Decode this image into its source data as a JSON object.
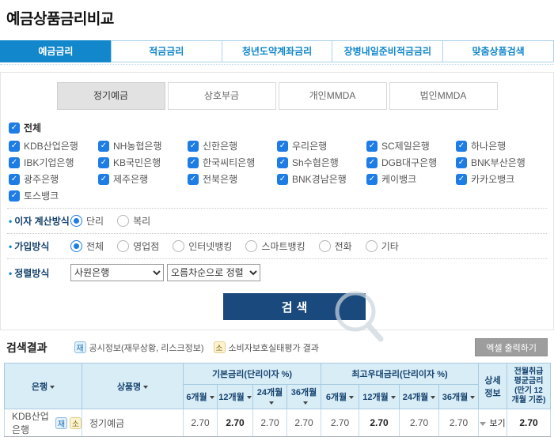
{
  "page": {
    "title": "예금상품금리비교"
  },
  "tabs": [
    {
      "label": "예금금리",
      "active": true
    },
    {
      "label": "적금금리",
      "active": false
    },
    {
      "label": "청년도약계좌금리",
      "active": false
    },
    {
      "label": "장병내일준비적금금리",
      "active": false
    },
    {
      "label": "맞춤상품검색",
      "active": false
    }
  ],
  "subtabs": [
    {
      "label": "정기예금",
      "active": true
    },
    {
      "label": "상호부금",
      "active": false
    },
    {
      "label": "개인MMDA",
      "active": false
    },
    {
      "label": "법인MMDA",
      "active": false
    }
  ],
  "banks": {
    "all_label": "전체",
    "items": [
      {
        "label": "KDB산업은행",
        "checked": true
      },
      {
        "label": "NH농협은행",
        "checked": true
      },
      {
        "label": "신한은행",
        "checked": true
      },
      {
        "label": "우리은행",
        "checked": true
      },
      {
        "label": "SC제일은행",
        "checked": true
      },
      {
        "label": "하나은행",
        "checked": true
      },
      {
        "label": "IBK기업은행",
        "checked": true
      },
      {
        "label": "KB국민은행",
        "checked": true
      },
      {
        "label": "한국씨티은행",
        "checked": true
      },
      {
        "label": "Sh수협은행",
        "checked": true
      },
      {
        "label": "DGB대구은행",
        "checked": true
      },
      {
        "label": "BNK부산은행",
        "checked": true
      },
      {
        "label": "광주은행",
        "checked": true
      },
      {
        "label": "제주은행",
        "checked": true
      },
      {
        "label": "전북은행",
        "checked": true
      },
      {
        "label": "BNK경남은행",
        "checked": true
      },
      {
        "label": "케이뱅크",
        "checked": true
      },
      {
        "label": "카카오뱅크",
        "checked": true
      },
      {
        "label": "토스뱅크",
        "checked": true
      }
    ]
  },
  "filters": {
    "interest_calc": {
      "label": "이자 계산방식",
      "options": [
        {
          "label": "단리",
          "selected": true
        },
        {
          "label": "복리",
          "selected": false
        }
      ]
    },
    "join_method": {
      "label": "가입방식",
      "options": [
        {
          "label": "전체",
          "selected": true
        },
        {
          "label": "영업점",
          "selected": false
        },
        {
          "label": "인터넷뱅킹",
          "selected": false
        },
        {
          "label": "스마트뱅킹",
          "selected": false
        },
        {
          "label": "전화",
          "selected": false
        },
        {
          "label": "기타",
          "selected": false
        }
      ]
    },
    "sort": {
      "label": "정렬방식",
      "select1_value": "사원은행",
      "select2_value": "오름차순으로 정렬"
    }
  },
  "search_button_label": "검색",
  "results": {
    "title": "검색결과",
    "legend": [
      {
        "badge": "재",
        "label": "공시정보(재무상황, 리스크정보)"
      },
      {
        "badge": "소",
        "label": "소비자보호실태평가 결과"
      }
    ],
    "excel_button_label": "엑셀 출력하기"
  },
  "table": {
    "col_bank": "은행",
    "col_product": "상품명",
    "group_base": "기본금리(단리이자 %)",
    "group_max": "최고우대금리(단리이자 %)",
    "periods": [
      "6개월",
      "12개월",
      "24개월",
      "36개월"
    ],
    "detail_lines": {
      "l1": "상세",
      "l2": "정보"
    },
    "avg_lines": {
      "l1": "전월취급",
      "l2": "평균금리",
      "l3": "(만기 12",
      "l4": "개월 기준)"
    },
    "rows": [
      {
        "bank": "KDB산업은행",
        "badges": [
          "재",
          "소"
        ],
        "product": "정기예금",
        "base": [
          "2.70",
          "2.70",
          "2.70",
          "2.70"
        ],
        "max": [
          "2.70",
          "2.70",
          "2.70",
          "2.70"
        ],
        "view_label": "보기",
        "avg": "2.70"
      }
    ]
  }
}
